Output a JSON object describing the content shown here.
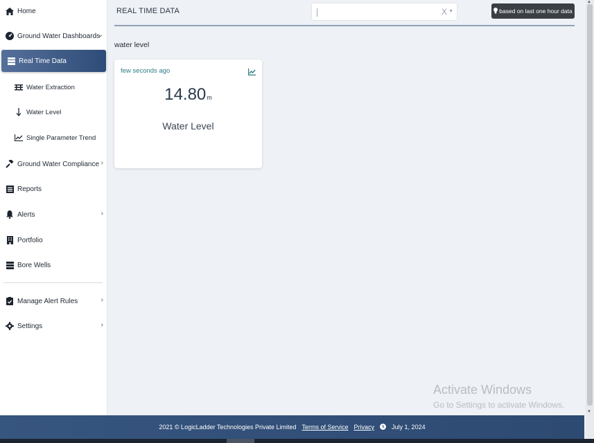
{
  "sidebar": {
    "home": "Home",
    "ground_water_dashboards": "Ground Water Dashboards",
    "real_time_data": "Real Time Data",
    "water_extraction": "Water Extraction",
    "water_level": "Water Level",
    "single_parameter_trend": "Single Parameter Trend",
    "ground_water_compliance": "Ground Water Compliance",
    "reports": "Reports",
    "alerts": "Alerts",
    "portfolio": "Portfolio",
    "bore_wells": "Bore Wells",
    "manage_alert_rules": "Manage Alert Rules",
    "settings": "Settings"
  },
  "header": {
    "title": "REAL TIME DATA",
    "select_clear": "X",
    "info_badge": "based on last one hour data"
  },
  "main": {
    "section_label": "water level",
    "card": {
      "updated": "few seconds ago",
      "value": "14.80",
      "unit": "m",
      "label": "Water Level"
    }
  },
  "footer": {
    "copyright": "2021 © LogicLadder Technologies Private Limited",
    "terms": "Terms of Service",
    "privacy": "Privacy",
    "date": "July 1, 2024"
  },
  "watermark": {
    "line1": "Activate Windows",
    "line2": "Go to Settings to activate Windows."
  },
  "colors": {
    "accent": "#2e4c78",
    "teal": "#2b7d86",
    "background": "#eef1f5"
  }
}
